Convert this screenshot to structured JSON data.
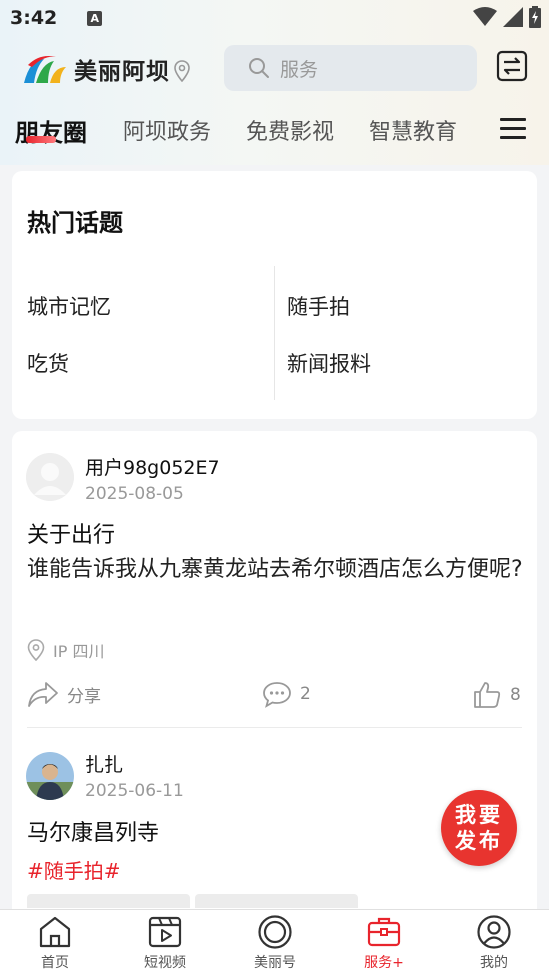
{
  "status_bar": {
    "time": "3:42",
    "notif_glyph": "A"
  },
  "header": {
    "app_name": "美丽阿坝",
    "search_placeholder": "服务",
    "accent": "#e8242c"
  },
  "category_tabs": [
    {
      "label": "朋友圈",
      "active": true
    },
    {
      "label": "阿坝政务"
    },
    {
      "label": "免费影视"
    },
    {
      "label": "智慧教育"
    }
  ],
  "hot_topics": {
    "title": "热门话题",
    "items": [
      "城市记忆",
      "随手拍",
      "吃货",
      "新闻报料"
    ]
  },
  "posts": [
    {
      "username": "用户98g052E7",
      "date": "2025-08-05",
      "title": "关于出行",
      "body": "谁能告诉我从九寨黄龙站去希尔顿酒店怎么方便呢?",
      "ip": "IP 四川",
      "share_label": "分享",
      "comments": "2",
      "likes": "8"
    },
    {
      "username": "扎扎",
      "date": "2025-06-11",
      "title": "马尔康昌列寺",
      "hashtag": "#随手拍#"
    }
  ],
  "fab": {
    "line1": "我要",
    "line2": "发布"
  },
  "bottom_nav": [
    {
      "label": "首页",
      "icon": "home-icon"
    },
    {
      "label": "短视频",
      "icon": "video-icon"
    },
    {
      "label": "美丽号",
      "icon": "circle-icon"
    },
    {
      "label": "服务+",
      "icon": "briefcase-icon",
      "active": true
    },
    {
      "label": "我的",
      "icon": "user-icon"
    }
  ]
}
